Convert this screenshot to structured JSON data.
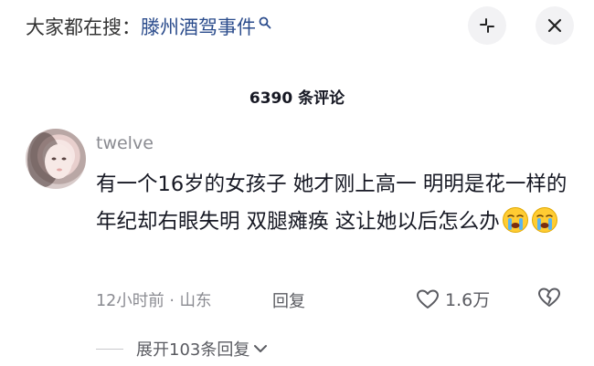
{
  "search": {
    "prefix": "大家都在搜：",
    "term": "滕州酒驾事件"
  },
  "header": {
    "comment_count": "6390 条评论"
  },
  "comment": {
    "username": "twelve",
    "text": "有一个16岁的女孩子 她才刚上高一 明明是花一样的年纪却右眼失明 双腿瘫痪 这让她以后怎么办",
    "emoji": "crying-face-emoji",
    "meta": "12小时前 · 山东",
    "reply_label": "回复",
    "like_count": "1.6万",
    "expand_label": "展开103条回复"
  },
  "icons": {
    "search": "search-icon",
    "collapse": "collapse-icon",
    "close": "close-icon",
    "like": "heart-icon",
    "dislike": "broken-heart-icon",
    "chevron": "chevron-down-icon"
  },
  "colors": {
    "search_term": "#2b4c8c",
    "secondary_text": "#8a8b91",
    "button_bg": "#f2f2f4"
  }
}
